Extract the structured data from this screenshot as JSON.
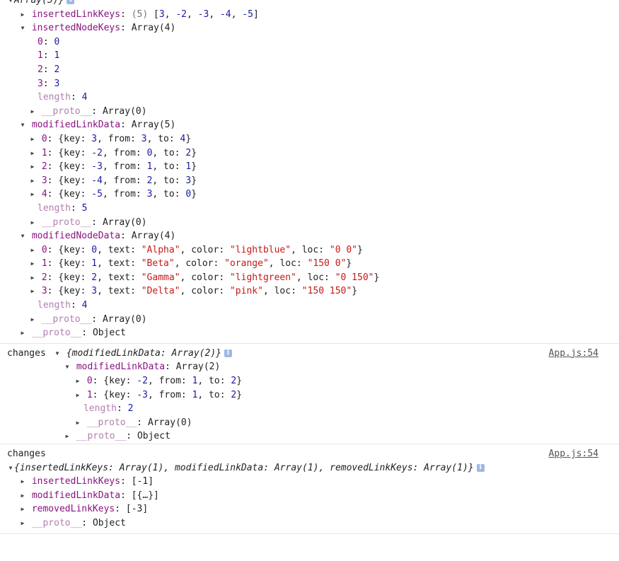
{
  "msg1": {
    "summary": "Array(5)}",
    "inserted_link_keys": {
      "key": "insertedLinkKeys",
      "count": "(5)",
      "preview_open": "[",
      "values": [
        "3",
        "-2",
        "-3",
        "-4",
        "-5"
      ],
      "preview_close": "]"
    },
    "inserted_node_keys": {
      "key": "insertedNodeKeys",
      "type": "Array(4)",
      "items": [
        {
          "idx": "0",
          "val": "0"
        },
        {
          "idx": "1",
          "val": "1"
        },
        {
          "idx": "2",
          "val": "2"
        },
        {
          "idx": "3",
          "val": "3"
        }
      ],
      "length_key": "length",
      "length_val": "4"
    },
    "modified_link_data": {
      "key": "modifiedLinkData",
      "type": "Array(5)",
      "items": [
        {
          "idx": "0",
          "key": "3",
          "from": "3",
          "to": "4"
        },
        {
          "idx": "1",
          "key": "-2",
          "from": "0",
          "to": "2"
        },
        {
          "idx": "2",
          "key": "-3",
          "from": "1",
          "to": "1"
        },
        {
          "idx": "3",
          "key": "-4",
          "from": "2",
          "to": "3"
        },
        {
          "idx": "4",
          "key": "-5",
          "from": "3",
          "to": "0"
        }
      ],
      "length_key": "length",
      "length_val": "5"
    },
    "modified_node_data": {
      "key": "modifiedNodeData",
      "type": "Array(4)",
      "items": [
        {
          "idx": "0",
          "key": "0",
          "text": "\"Alpha\"",
          "color": "\"lightblue\"",
          "loc": "\"0 0\""
        },
        {
          "idx": "1",
          "key": "1",
          "text": "\"Beta\"",
          "color": "\"orange\"",
          "loc": "\"150 0\""
        },
        {
          "idx": "2",
          "key": "2",
          "text": "\"Gamma\"",
          "color": "\"lightgreen\"",
          "loc": "\"0 150\""
        },
        {
          "idx": "3",
          "key": "3",
          "text": "\"Delta\"",
          "color": "\"pink\"",
          "loc": "\"150 150\""
        }
      ],
      "length_key": "length",
      "length_val": "4"
    },
    "proto_key": "__proto__",
    "proto_array": "Array(0)",
    "proto_object": "Object"
  },
  "msg2": {
    "prefix": "changes",
    "summary_key": "modifiedLinkData",
    "summary_type": "Array(2)",
    "source": "App.js:54",
    "modified_link_data": {
      "key": "modifiedLinkData",
      "type": "Array(2)",
      "items": [
        {
          "idx": "0",
          "key": "-2",
          "from": "1",
          "to": "2"
        },
        {
          "idx": "1",
          "key": "-3",
          "from": "1",
          "to": "2"
        }
      ],
      "length_key": "length",
      "length_val": "2"
    },
    "proto_key": "__proto__",
    "proto_array": "Array(0)",
    "proto_object": "Object"
  },
  "msg3": {
    "prefix": "changes",
    "source": "App.js:54",
    "summary": "{insertedLinkKeys: Array(1), modifiedLinkData: Array(1), removedLinkKeys: Array(1)}",
    "inserted_link_keys": {
      "key": "insertedLinkKeys",
      "preview": "[-1]"
    },
    "modified_link_data": {
      "key": "modifiedLinkData",
      "preview": "[{…}]"
    },
    "removed_link_keys": {
      "key": "removedLinkKeys",
      "preview": "[-3]"
    },
    "proto_key": "__proto__",
    "proto_object": "Object"
  },
  "labels": {
    "key": "key",
    "from": "from",
    "to": "to",
    "text": "text",
    "color": "color",
    "loc": "loc"
  },
  "icons": {
    "expanded": "triangle-down-icon",
    "collapsed": "triangle-right-icon",
    "info": "info-icon"
  }
}
